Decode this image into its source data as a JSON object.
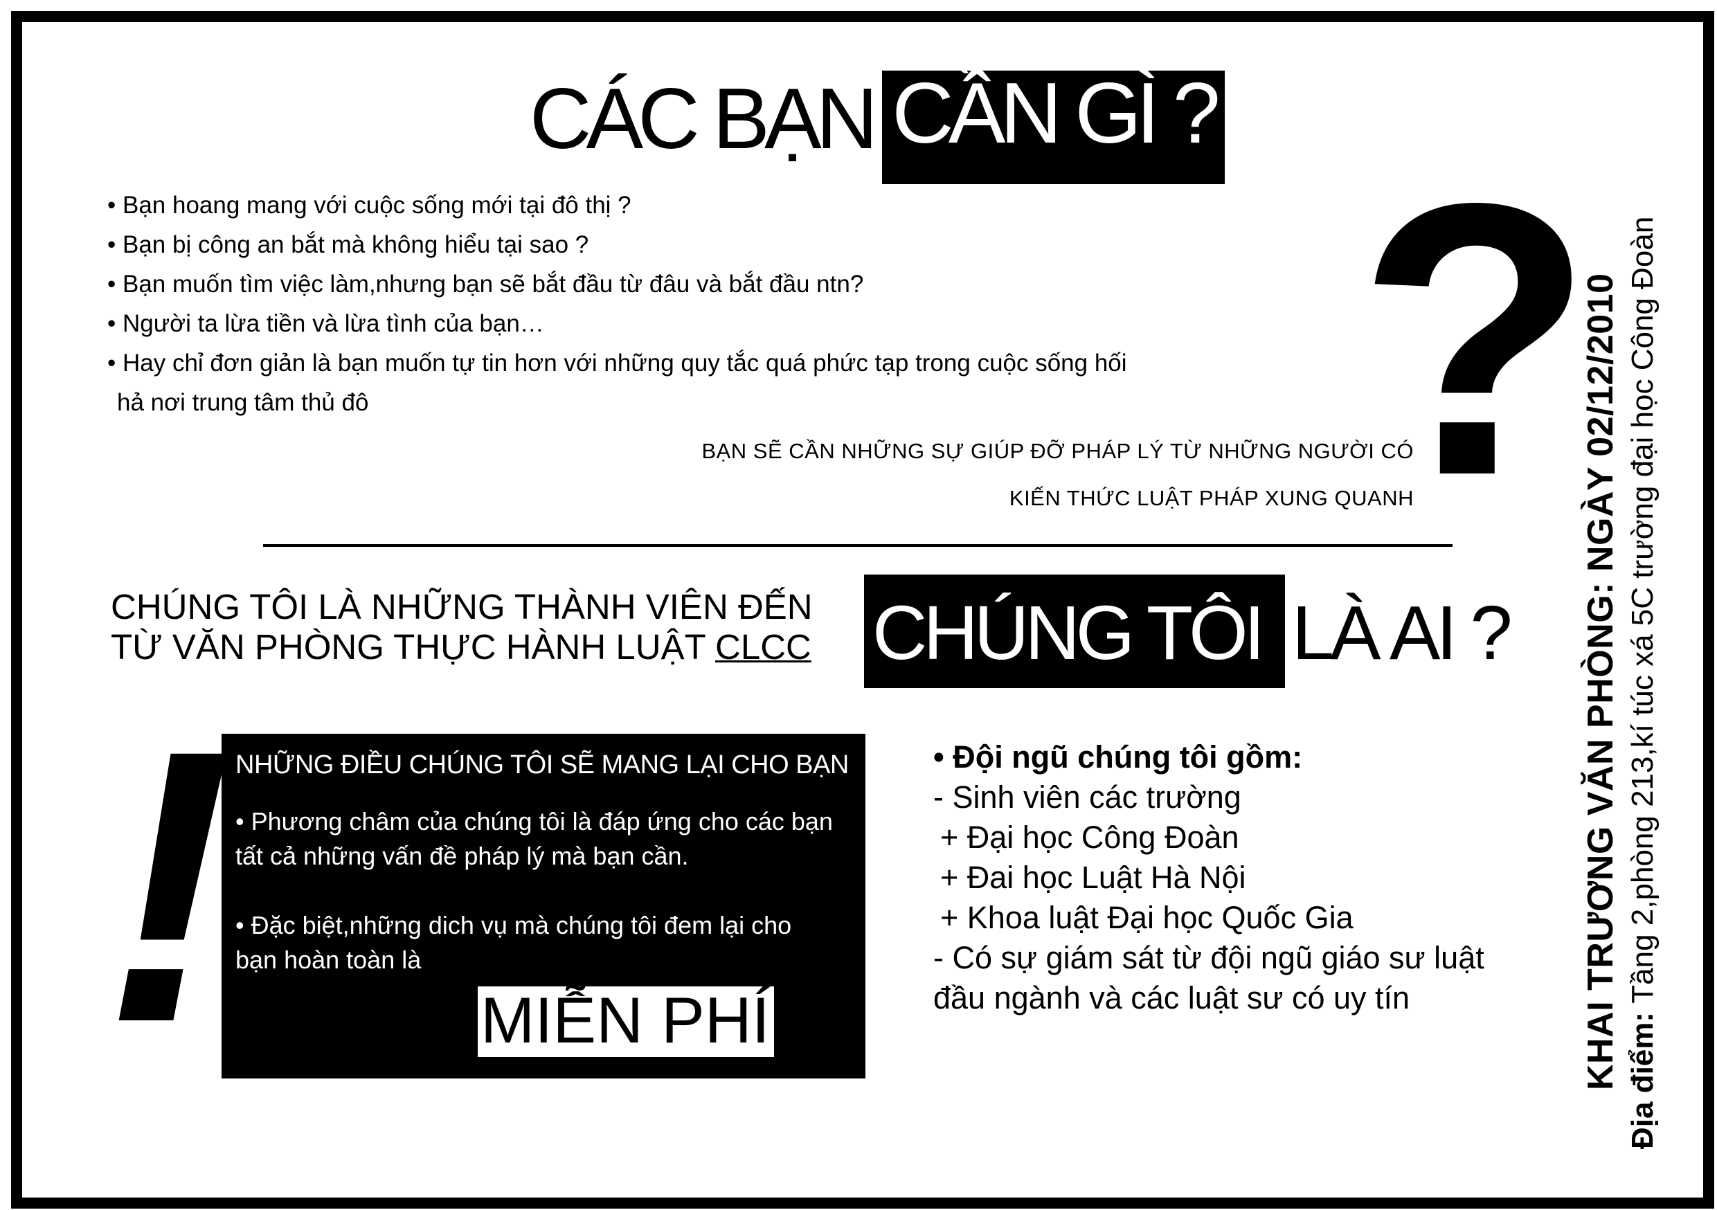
{
  "header": {
    "title_part1": "CÁC BẠN",
    "title_part2": "CẦN GÌ ?"
  },
  "questions": [
    "• Bạn hoang mang với cuộc sống mới tại đô thị ?",
    "• Bạn bị công an bắt mà  không hiểu tại sao ?",
    "• Bạn muốn tìm việc làm,nhưng bạn sẽ bắt đầu từ đâu  và bắt đầu ntn?",
    "• Người ta lừa tiền và lừa tình của bạn…",
    "• Hay chỉ đơn giản là bạn muốn tự tin hơn với những quy tắc quá phức tạp trong cuộc sống hối",
    " hả nơi trung tâm thủ đô"
  ],
  "note": {
    "line1": "BẠN SẼ CẦN NHỮNG SỰ GIÚP ĐỠ PHÁP LÝ TỪ NHỮNG NGƯỜI CÓ",
    "line2": "KIẾN THỨC LUẬT PHÁP XUNG QUANH"
  },
  "big_symbols": {
    "question_mark": "?",
    "exclamation": "!"
  },
  "who": {
    "line1": "CHÚNG TÔI LÀ NHỮNG THÀNH VIÊN ĐẾN",
    "line2_prefix": "TỪ VĂN PHÒNG THỰC HÀNH LUẬT ",
    "line2_underlined": "CLCC",
    "heading_part1": "CHÚNG TÔI",
    "heading_part2": "LÀ AI ?"
  },
  "offer": {
    "title": "NHỮNG ĐIỀU CHÚNG TÔI SẼ MANG LẠI CHO BẠN",
    "p1_line1": "• Phương châm của chúng tôi là đáp ứng cho các bạn",
    "p1_line2": "tất cả những vấn đề pháp lý mà bạn cần.",
    "p2_line1": "• Đặc biệt,những dich vụ mà chúng tôi đem lại cho",
    "p2_line2": "bạn hoàn toàn là",
    "free": "MIỄN PHÍ"
  },
  "team": {
    "heading": "• Đội ngũ chúng tôi gồm:",
    "lines": [
      "- Sinh viên các trường",
      " + Đại học Công Đoàn",
      " + Đai học Luật Hà Nội",
      " + Khoa luật Đại học Quốc Gia",
      "- Có sự giám sát từ đội ngũ giáo sư luật",
      "đầu ngành và các luật sư có uy tín"
    ]
  },
  "sidebar": {
    "opening": "KHAI TRƯƠNG VĂN PHÒNG: NGÀY 02/12/2010",
    "location_label": "Địa điểm: ",
    "location_value": "Tầng 2,phòng 213,kí túc xá 5C trường đại học Công Đoàn"
  }
}
